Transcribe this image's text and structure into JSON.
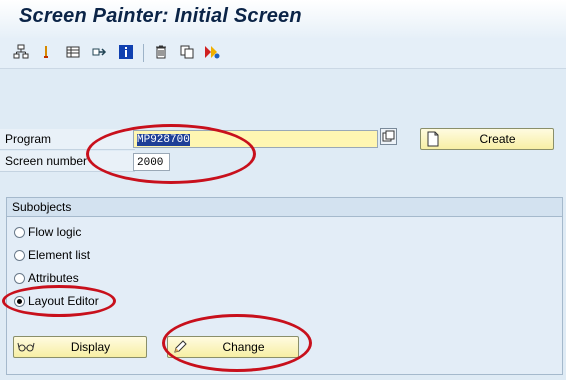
{
  "window": {
    "title": "Screen Painter: Initial Screen"
  },
  "toolbar": {
    "icons": [
      "hierarchy-icon",
      "where-used-icon",
      "display-objects-icon",
      "navigate-icon",
      "info-icon",
      "delete-icon",
      "copy-icon",
      "test-icon"
    ]
  },
  "form": {
    "program_label": "Program",
    "program_value": "MP928700",
    "screen_number_label": "Screen number",
    "screen_number_value": "2000",
    "create_label": "Create"
  },
  "subobjects": {
    "title": "Subobjects",
    "options": [
      {
        "label": "Flow logic",
        "checked": false
      },
      {
        "label": "Element list",
        "checked": false
      },
      {
        "label": "Attributes",
        "checked": false
      },
      {
        "label": "Layout Editor",
        "checked": true
      }
    ]
  },
  "actions": {
    "display_label": "Display",
    "change_label": "Change"
  },
  "annotations": {
    "color": "#c8101c"
  }
}
